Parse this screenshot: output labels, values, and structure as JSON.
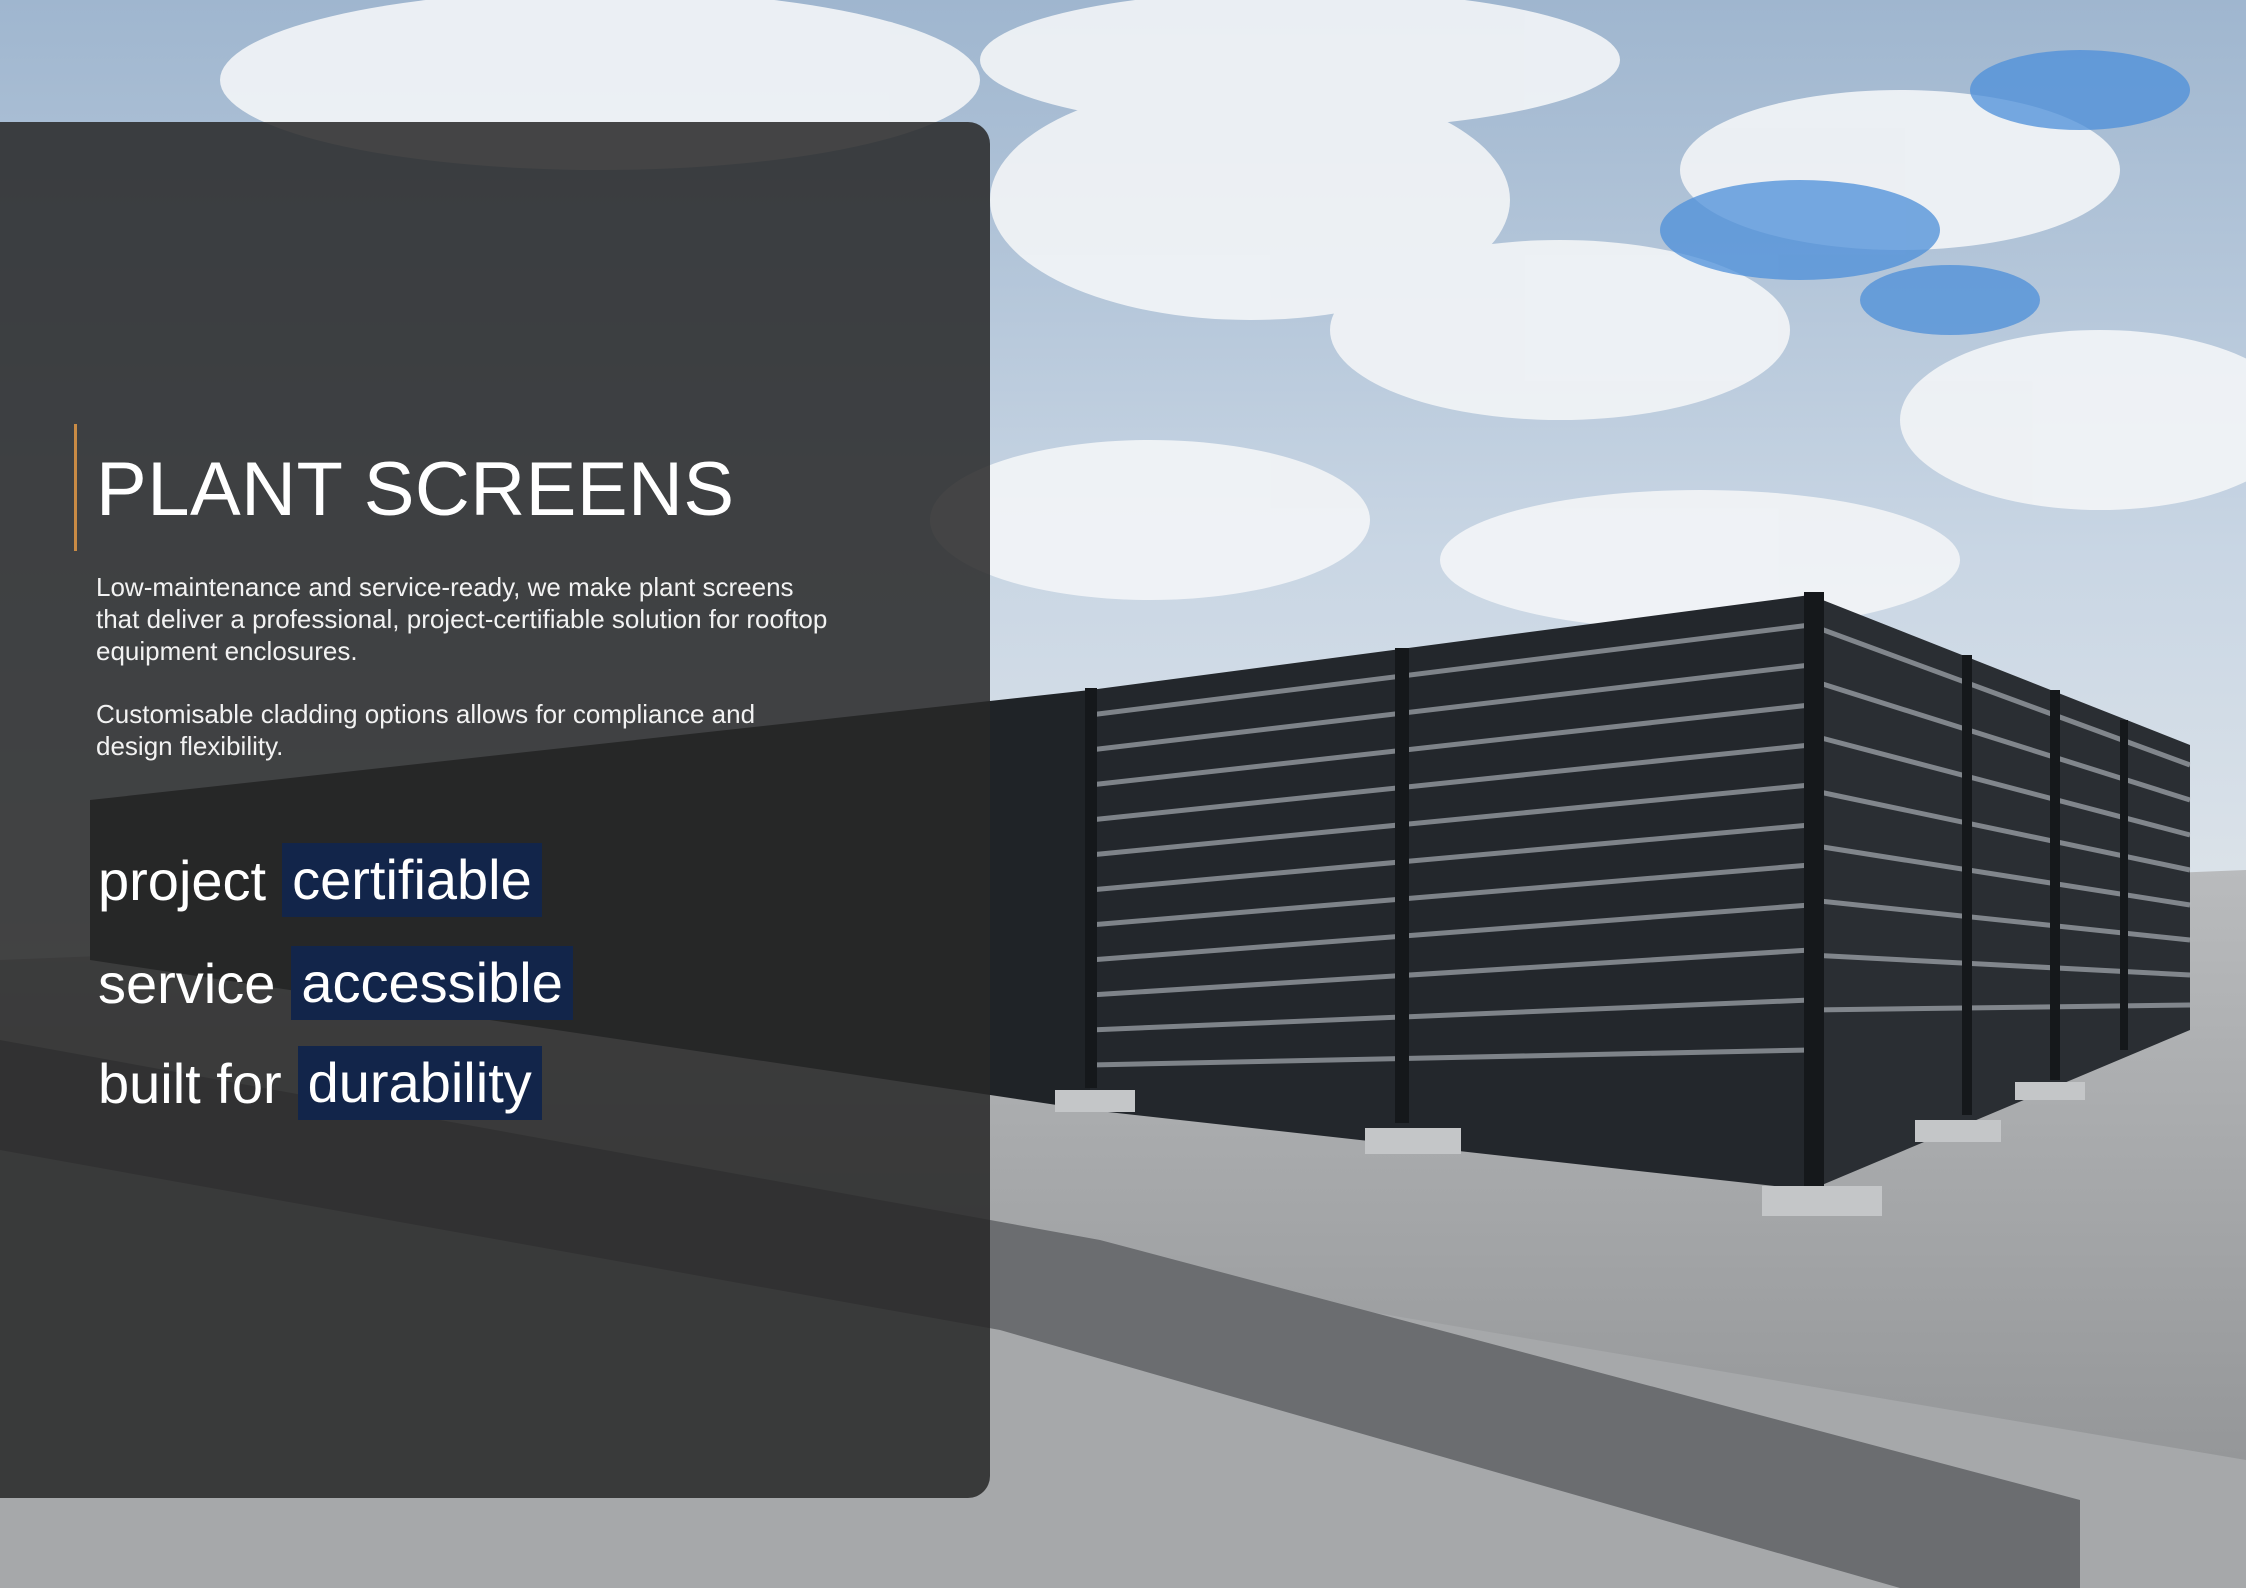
{
  "title": "PLANT SCREENS",
  "intro": "Low-maintenance and service-ready, we make plant screens that deliver a professional, project-certifiable solution for rooftop equipment enclosures.",
  "detail": "Customisable cladding options allows for compliance and design flexibility.",
  "features": [
    {
      "word": "project",
      "highlight": "certifiable"
    },
    {
      "word": "service",
      "highlight": "accessible"
    },
    {
      "word": "built for",
      "highlight": "durability"
    }
  ],
  "colors": {
    "accent": "#c98b45",
    "highlight": "#12254a",
    "overlay": "#282828"
  }
}
